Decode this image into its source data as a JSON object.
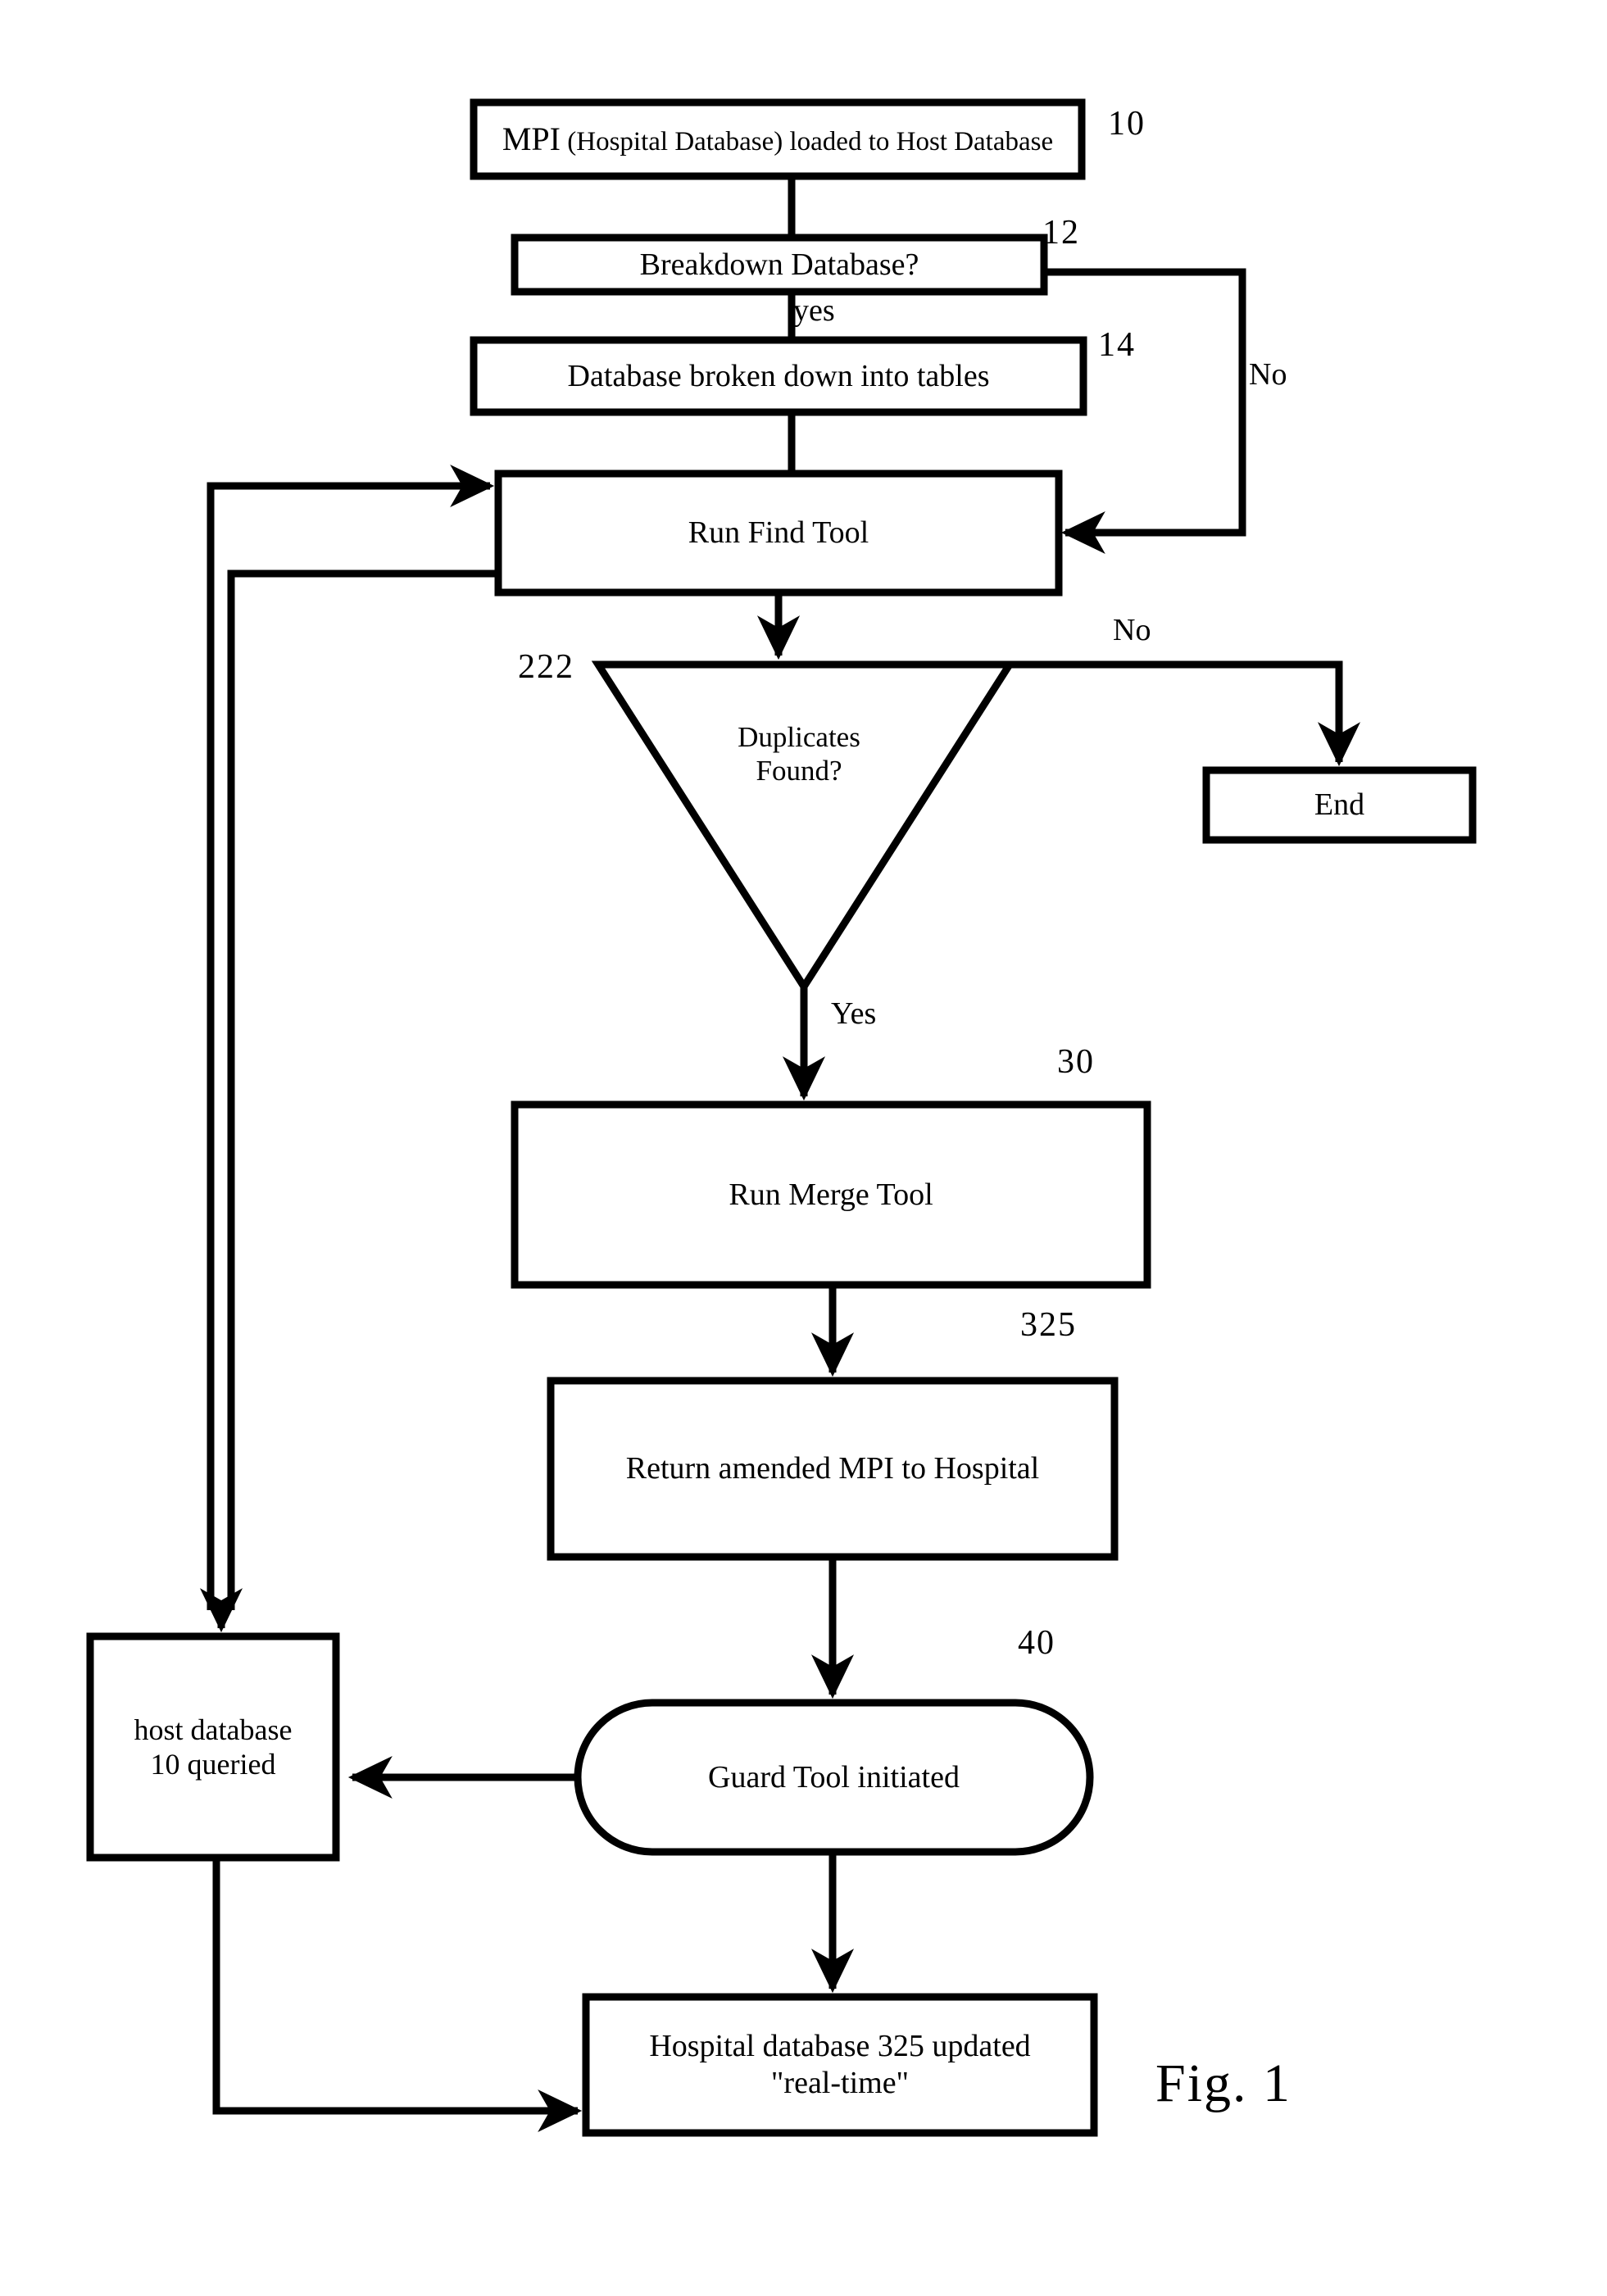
{
  "figure": {
    "caption": "Fig. 1",
    "title": "MPI duplicate find-and-merge process flowchart"
  },
  "nodes": {
    "mpi_loaded": {
      "label_main": "MPI",
      "label_rest": " (Hospital Database) loaded to Host Database",
      "ref": "10",
      "shape": "rectangle"
    },
    "breakdown_database": {
      "label": "Breakdown Database?",
      "ref": "12",
      "shape": "rectangle"
    },
    "database_broken_down": {
      "label": "Database broken down into tables",
      "ref": "14",
      "shape": "rectangle"
    },
    "run_find_tool": {
      "label": "Run Find Tool",
      "ref": "",
      "shape": "rectangle"
    },
    "duplicates_found": {
      "label": "Duplicates\nFound?",
      "ref": "222",
      "shape": "triangle"
    },
    "end": {
      "label": "End",
      "ref": "",
      "shape": "rectangle"
    },
    "run_merge_tool": {
      "label": "Run Merge Tool",
      "ref": "30",
      "shape": "rectangle"
    },
    "return_amended_mpi": {
      "label": "Return amended MPI to Hospital",
      "ref": "325",
      "shape": "rectangle"
    },
    "host_database_queried": {
      "label": "host database\n10 queried",
      "ref": "",
      "shape": "rectangle"
    },
    "guard_tool": {
      "label": "Guard Tool initiated",
      "ref": "40",
      "shape": "stadium"
    },
    "hospital_database_updated": {
      "label": "Hospital database 325 updated\n\"real-time\"",
      "ref": "",
      "shape": "rectangle"
    }
  },
  "edge_labels": {
    "breakdown_yes": "yes",
    "breakdown_no": "No",
    "duplicates_no": "No",
    "duplicates_yes": "Yes"
  },
  "colors": {
    "stroke": "#000000",
    "background": "#ffffff",
    "text": "#000000"
  }
}
